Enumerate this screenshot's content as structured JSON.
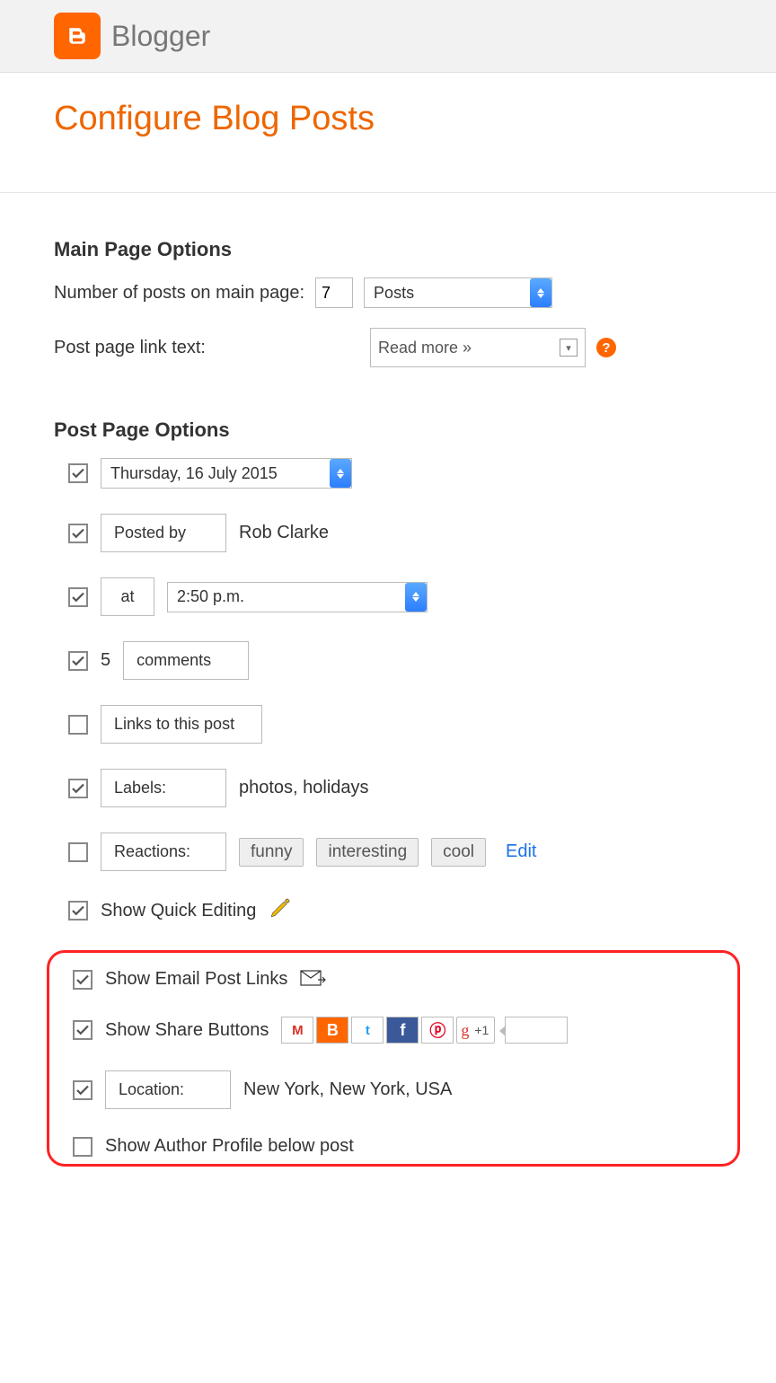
{
  "header": {
    "brand": "Blogger"
  },
  "page_title": "Configure Blog Posts",
  "main_page_options": {
    "heading": "Main Page Options",
    "num_posts_label": "Number of posts on main page:",
    "num_posts_value": "7",
    "select_value": "Posts",
    "link_text_label": "Post page link text:",
    "link_text_value": "Read more »"
  },
  "post_page_options": {
    "heading": "Post Page Options",
    "date_checked": true,
    "date_value": "Thursday, 16 July 2015",
    "posted_by_checked": true,
    "posted_by_label": "Posted by",
    "posted_by_value": "Rob Clarke",
    "time_checked": true,
    "time_label": "at",
    "time_value": "2:50 p.m.",
    "comments_checked": true,
    "comments_count": "5",
    "comments_label": "comments",
    "links_checked": false,
    "links_label": "Links to this post",
    "labels_checked": true,
    "labels_label": "Labels:",
    "labels_value": "photos, holidays",
    "reactions_checked": false,
    "reactions_label": "Reactions:",
    "reactions": [
      "funny",
      "interesting",
      "cool"
    ],
    "edit_link": "Edit",
    "quick_edit_checked": true,
    "quick_edit_label": "Show Quick Editing",
    "email_links_checked": true,
    "email_links_label": "Show Email Post Links",
    "share_checked": true,
    "share_label": "Show Share Buttons",
    "location_checked": true,
    "location_label": "Location:",
    "location_value": "New York, New York, USA",
    "author_profile_checked": false,
    "author_profile_label": "Show Author Profile below post"
  }
}
